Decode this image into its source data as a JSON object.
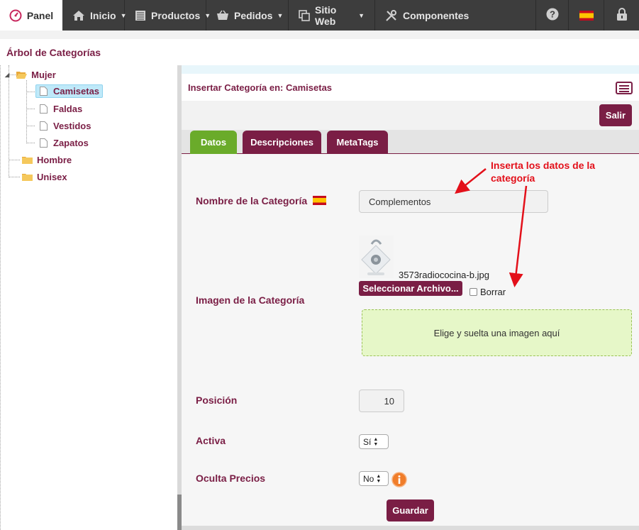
{
  "topnav": {
    "panel": "Panel",
    "items": [
      {
        "label": "Inicio",
        "icon": "home-icon"
      },
      {
        "label": "Productos",
        "icon": "products-icon"
      },
      {
        "label": "Pedidos",
        "icon": "basket-icon"
      },
      {
        "label": "Sitio Web",
        "icon": "website-icon"
      },
      {
        "label": "Componentes",
        "icon": "tools-icon"
      }
    ],
    "right_icons": [
      "help-icon",
      "spain-flag-icon",
      "lock-icon"
    ]
  },
  "page": {
    "title": "Árbol de Categorías"
  },
  "tree": {
    "mujer": "Mujer",
    "children": [
      "Camisetas",
      "Faldas",
      "Vestidos",
      "Zapatos"
    ],
    "selected": "Camisetas",
    "hombre": "Hombre",
    "unisex": "Unisex"
  },
  "main": {
    "heading": "Insertar Categoría en: Camisetas",
    "exit_button": "Salir",
    "tabs": [
      "Datos",
      "Descripciones",
      "MetaTags"
    ],
    "active_tab": "Datos",
    "fields": {
      "name_label": "Nombre de la Categoría",
      "name_value": "Complementos",
      "image_label": "Imagen de la Categoría",
      "image_filename": "3573radiococina-b.jpg",
      "select_file_button": "Seleccionar Archivo...",
      "delete_label": "Borrar",
      "dropzone_text": "Elige y suelta una imagen aquí",
      "position_label": "Posición",
      "position_value": "10",
      "active_label": "Activa",
      "active_value": "Sí",
      "hide_prices_label": "Oculta Precios",
      "hide_prices_value": "No"
    },
    "save_button": "Guardar"
  },
  "annotation": {
    "line1": "Inserta los datos de la",
    "line2": "categoría"
  },
  "colors": {
    "brand": "#7a1e45",
    "active_tab": "#6aab2a",
    "nav_bg": "#3d3d3d",
    "annotation": "#e3101a"
  }
}
